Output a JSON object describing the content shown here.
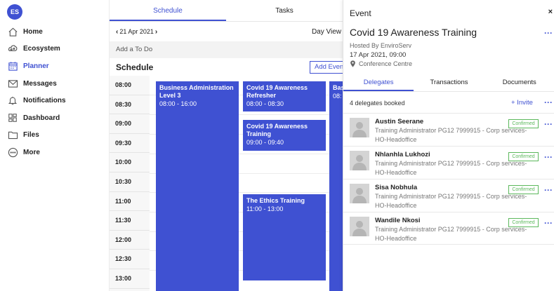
{
  "user": {
    "initials": "ES"
  },
  "sidebar": {
    "items": [
      {
        "label": "Home",
        "icon": "home-icon"
      },
      {
        "label": "Ecosystem",
        "icon": "ecosystem-icon"
      },
      {
        "label": "Planner",
        "icon": "calendar-icon",
        "active": true
      },
      {
        "label": "Messages",
        "icon": "envelope-icon"
      },
      {
        "label": "Notifications",
        "icon": "bell-icon"
      },
      {
        "label": "Dashboard",
        "icon": "dashboard-icon"
      },
      {
        "label": "Files",
        "icon": "folder-icon"
      },
      {
        "label": "More",
        "icon": "more-icon"
      }
    ]
  },
  "main": {
    "tabs": [
      {
        "label": "Schedule"
      },
      {
        "label": "Tasks"
      }
    ],
    "date": "21 Apr 2021",
    "view": "Day View",
    "todo_placeholder": "Add a To Do",
    "schedule_title": "Schedule",
    "add_event_label": "Add Event",
    "times": [
      "08:00",
      "08:30",
      "09:00",
      "09:30",
      "10:00",
      "10:30",
      "11:00",
      "11:30",
      "12:00",
      "12:30",
      "13:00"
    ],
    "events": [
      {
        "title": "Business Administration Level 3",
        "time": "08:00 - 16:00"
      },
      {
        "title": "Covid 19 Awareness Refresher",
        "time": "08:00 - 08:30"
      },
      {
        "title": "Covid 19 Awareness Training",
        "time": "09:00 - 09:40"
      },
      {
        "title": "The Ethics Training",
        "time": "11:00 - 13:00"
      },
      {
        "title": "Bas",
        "time": "08:"
      }
    ]
  },
  "panel": {
    "heading": "Event",
    "close_label": "×",
    "event_title": "Covid 19 Awareness Training",
    "host": "Hosted By EnviroServ",
    "datetime": "17 Apr 2021, 09:00",
    "location": "Conference Centre",
    "tabs": [
      {
        "label": "Delegates"
      },
      {
        "label": "Transactions"
      },
      {
        "label": "Documents"
      }
    ],
    "delegate_count": "4 delegates booked",
    "invite_label": "+ Invite",
    "delegates": [
      {
        "name": "Austin Seerane",
        "role": "Training Administrator PG12 7999915 - Corp services-HO-Headoffice",
        "status": "Confirmed"
      },
      {
        "name": "Nhlanhla Lukhozi",
        "role": "Training Administrator PG12 7999915 - Corp services-HO-Headoffice",
        "status": "Confirmed"
      },
      {
        "name": "Sisa Nobhula",
        "role": "Training Administrator PG12 7999915 - Corp services-HO-Headoffice",
        "status": "Confirmed"
      },
      {
        "name": "Wandile Nkosi",
        "role": "Training Administrator PG12 7999915 - Corp services-HO-Headoffice",
        "status": "Confirmed"
      }
    ]
  },
  "colors": {
    "accent": "#3f51d2",
    "confirmed": "#5cb85c"
  }
}
